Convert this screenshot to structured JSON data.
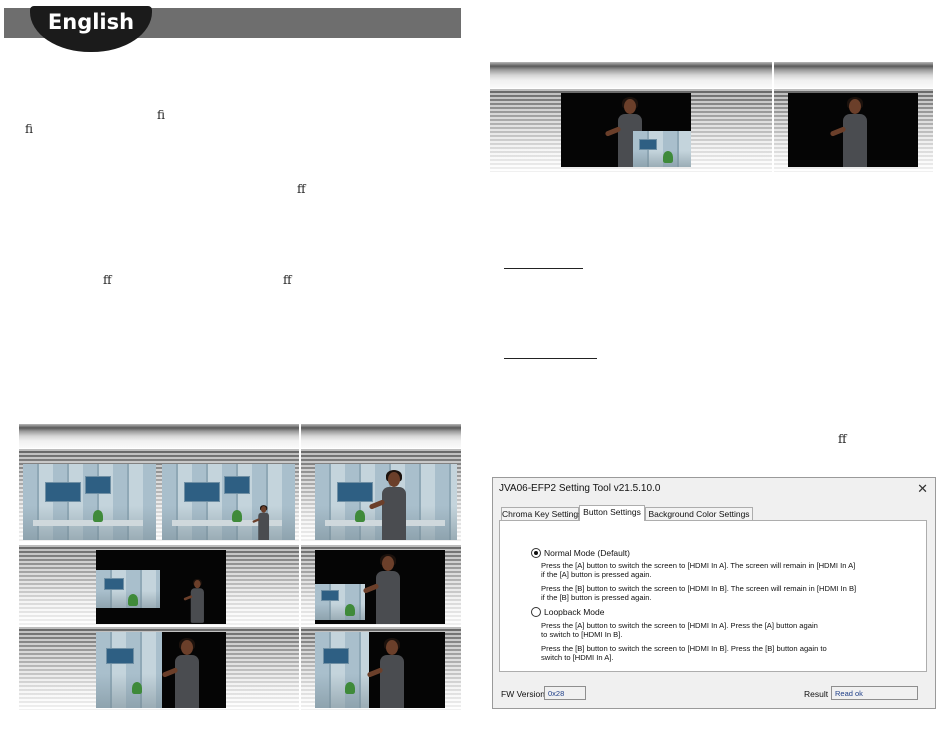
{
  "header": {
    "language": "English"
  },
  "ligatures": [
    "ﬁ",
    "ﬁ",
    "ﬀ",
    "ﬀ",
    "ﬀ",
    "ﬀ"
  ],
  "setting_tool": {
    "title": "JVA06-EFP2 Setting Tool v21.5.10.0",
    "tabs": [
      {
        "label": "Chroma Key Settings",
        "active": false
      },
      {
        "label": "Button Settings",
        "active": true
      },
      {
        "label": "Background Color Settings",
        "active": false
      }
    ],
    "normal_mode": {
      "label": "Normal Mode (Default)",
      "selected": true,
      "lines": [
        "Press the [A] button to switch the screen to [HDMI In A]. The screen will remain in [HDMI In A]",
        "if the [A] button is pressed again.",
        "Press the [B] button to switch the screen to [HDMI In B]. The screen will remain in [HDMI In  B]",
        "if the [B] button is pressed again."
      ]
    },
    "loopback_mode": {
      "label": "Loopback Mode",
      "selected": false,
      "lines": [
        "Press the [A] button to switch the screen to [HDMI In A]. Press the [A] button again",
        "to switch to [HDMI In B].",
        "Press the [B] button to switch the screen to [HDMI In B]. Press the  [B] button again to",
        "switch to [HDMI In A]."
      ]
    },
    "footer": {
      "fw_label": "FW Version :",
      "fw_value": "0x28",
      "result_label": "Result :",
      "result_value": "Read ok"
    }
  }
}
